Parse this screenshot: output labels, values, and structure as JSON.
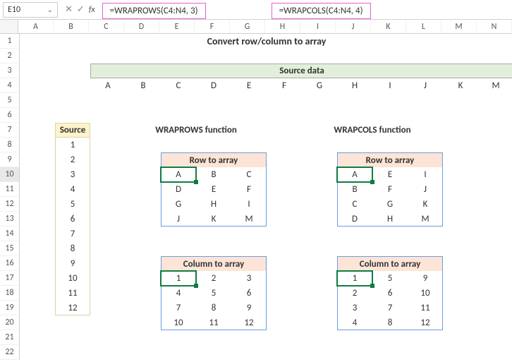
{
  "nameBox": "E10",
  "fxSymbols": {
    "cancel": "✕",
    "accept": "✓",
    "fx": "fx"
  },
  "formula1": "=WRAPROWS(C4:N4, 3)",
  "formula2": "=WRAPCOLS(C4:N4, 4)",
  "cols": [
    "A",
    "B",
    "C",
    "D",
    "E",
    "F",
    "G",
    "H",
    "I",
    "J",
    "K",
    "L",
    "M",
    "N"
  ],
  "rows": [
    "1",
    "2",
    "3",
    "4",
    "5",
    "6",
    "7",
    "8",
    "9",
    "10",
    "11",
    "12",
    "13",
    "14",
    "15",
    "16",
    "17",
    "18",
    "19",
    "20",
    "21",
    "22"
  ],
  "title": "Convert row/column to array",
  "sourceDataHeader": "Source data",
  "sourceRow": [
    "A",
    "B",
    "C",
    "D",
    "E",
    "F",
    "G",
    "H",
    "I",
    "J",
    "K",
    "M"
  ],
  "sourceColHeader": "Source",
  "sourceCol": [
    "1",
    "2",
    "3",
    "4",
    "5",
    "6",
    "7",
    "8",
    "9",
    "10",
    "11",
    "12"
  ],
  "wraprows": {
    "title": "WRAPROWS function",
    "rowHeader": "Row to array",
    "rowArr": [
      [
        "A",
        "B",
        "C"
      ],
      [
        "D",
        "E",
        "F"
      ],
      [
        "G",
        "H",
        "I"
      ],
      [
        "J",
        "K",
        "M"
      ]
    ],
    "colHeader": "Column to array",
    "colArr": [
      [
        "1",
        "2",
        "3"
      ],
      [
        "4",
        "5",
        "6"
      ],
      [
        "7",
        "8",
        "9"
      ],
      [
        "10",
        "11",
        "12"
      ]
    ]
  },
  "wrapcols": {
    "title": "WRAPCOLS function",
    "rowHeader": "Row to array",
    "rowArr": [
      [
        "A",
        "E",
        "I"
      ],
      [
        "B",
        "F",
        "J"
      ],
      [
        "C",
        "G",
        "K"
      ],
      [
        "D",
        "H",
        "M"
      ]
    ],
    "colHeader": "Column to array",
    "colArr": [
      [
        "1",
        "5",
        "9"
      ],
      [
        "2",
        "6",
        "10"
      ],
      [
        "3",
        "7",
        "11"
      ],
      [
        "4",
        "8",
        "12"
      ]
    ]
  }
}
